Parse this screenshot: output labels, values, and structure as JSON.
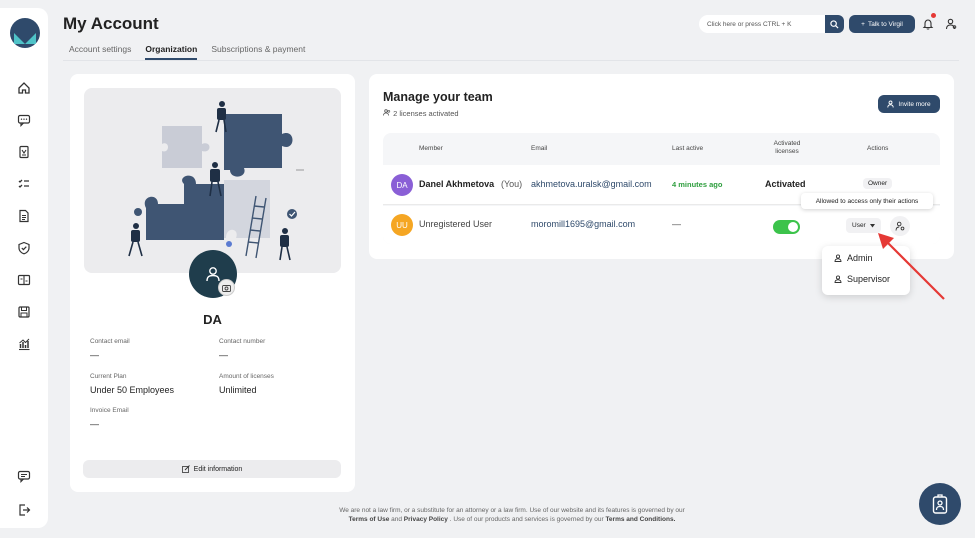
{
  "header": {
    "title": "My Account",
    "tabs": [
      {
        "label": "Account settings"
      },
      {
        "label": "Organization"
      },
      {
        "label": "Subscriptions & payment"
      }
    ],
    "search_placeholder": "Click here or press CTRL + K",
    "talk_label": "Talk to Virgil"
  },
  "sidebar": {
    "icons": [
      "home-icon",
      "chat-icon",
      "document-scan-icon",
      "checklist-icon",
      "file-icon",
      "shield-icon",
      "compare-icon",
      "save-icon",
      "analytics-icon",
      "feedback-icon",
      "logout-icon"
    ]
  },
  "profile": {
    "initials": "DA",
    "fields": {
      "contact_email_label": "Contact email",
      "contact_email_value": "—",
      "contact_number_label": "Contact number",
      "contact_number_value": "—",
      "current_plan_label": "Current Plan",
      "current_plan_value": "Under 50 Employees",
      "licenses_label": "Amount of licenses",
      "licenses_value": "Unlimited",
      "invoice_email_label": "Invoice Email",
      "invoice_email_value": "—"
    },
    "edit_label": "Edit information"
  },
  "team": {
    "title": "Manage your team",
    "licenses_activated": "2 licenses activated",
    "invite_label": "Invite more",
    "columns": {
      "member": "Member",
      "email": "Email",
      "last_active": "Last active",
      "activated": "Activated licenses",
      "actions": "Actions"
    },
    "rows": [
      {
        "initials": "DA",
        "name": "Danel Akhmetova",
        "you": "(You)",
        "email": "akhmetova.uralsk@gmail.com",
        "last_active": "4 minutes ago",
        "activated": "Activated",
        "action": "Owner"
      },
      {
        "initials": "UU",
        "name": "Unregistered User",
        "email": "moromill1695@gmail.com",
        "last_active": "—",
        "activated_toggle": true,
        "action": "User"
      }
    ],
    "tooltip": "Allowed to access only their actions",
    "role_menu": [
      "Admin",
      "Supervisor"
    ]
  },
  "footer": {
    "line1": "We are not a law firm, or a substitute for an attorney or a law firm. Use of our website and its features is governed by our",
    "terms": "Terms of Use",
    "and": "and",
    "privacy": "Privacy Policy",
    "line2_mid": ". Use of our products and services is governed by our",
    "conditions": "Terms and Conditions."
  },
  "colors": {
    "primary": "#2f4a6b",
    "success": "#2e9e3e",
    "toggle": "#3cc34b",
    "annotation_arrow": "#e53935"
  }
}
